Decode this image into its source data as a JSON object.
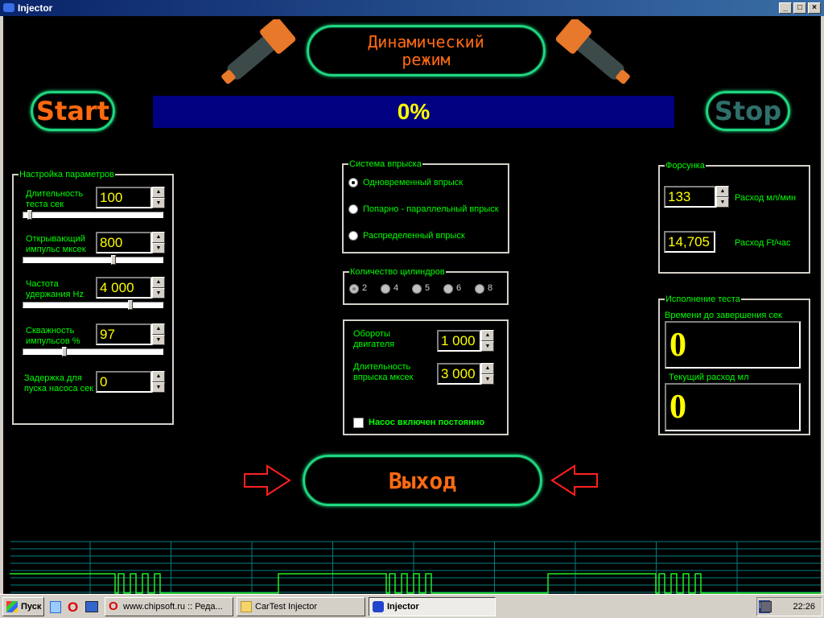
{
  "window": {
    "title": "Injector",
    "controls": [
      "_",
      "□",
      "×"
    ]
  },
  "header": {
    "title_line1": "Динамический",
    "title_line2": "режим"
  },
  "toolbar": {
    "start_label": "Start",
    "stop_label": "Stop",
    "progress_text": "0%",
    "progress_value": 0
  },
  "params": {
    "group_label": "Настройка параметров",
    "items": [
      {
        "label1": "Длительность",
        "label2": "теста сек",
        "value": "100",
        "slider_fraction": 0.03
      },
      {
        "label1": "Открывающий",
        "label2": "импульс мксек",
        "value": "800",
        "slider_fraction": 0.66
      },
      {
        "label1": "Частота",
        "label2": "удержания Hz",
        "value": "4 000",
        "slider_fraction": 0.79
      },
      {
        "label1": "Скважность",
        "label2": "импульсов %",
        "value": "97",
        "slider_fraction": 0.29
      },
      {
        "label1": "Задержка для",
        "label2": "пуска насоса сек",
        "value": "0"
      }
    ]
  },
  "injection": {
    "group_label": "Система впрыска",
    "options": [
      "Одновременный впрыск",
      "Попарно - параллельный впрыск",
      "Распределенный впрыск"
    ],
    "selected": 0
  },
  "cylinders": {
    "group_label": "Количество цилиндров",
    "options": [
      "2",
      "4",
      "5",
      "6",
      "8"
    ],
    "selected": 0
  },
  "engine": {
    "rpm_label1": "Обороты",
    "rpm_label2": "двигателя",
    "rpm_value": "1 000",
    "dur_label1": "Длительность",
    "dur_label2": "впрыска мксек",
    "dur_value": "3 000",
    "pump_label": "Насос включен постоянно",
    "pump_checked": false
  },
  "injector": {
    "group_label": "Форсунка",
    "flow_value": "133",
    "flow_label": "Расход мл/мин",
    "ft_value": "14,705",
    "ft_label": "Расход Ft/час"
  },
  "test": {
    "group_label": "Исполнение теста",
    "remaining_label": "Времени до завершения сек",
    "remaining_value": "0",
    "current_label": "Текущий расход мл",
    "current_value": "0"
  },
  "exit_label": "Выход",
  "taskbar": {
    "start": "Пуск",
    "tasks": [
      "www.chipsoft.ru :: Реда...",
      "CarTest Injector",
      "Injector"
    ],
    "lang": "RL",
    "clock": "22:26"
  },
  "colors": {
    "accent": "#ff6a10",
    "label": "#00ff00",
    "value": "#ffff00",
    "pill": "#1fd67f",
    "progress": "#000080"
  }
}
